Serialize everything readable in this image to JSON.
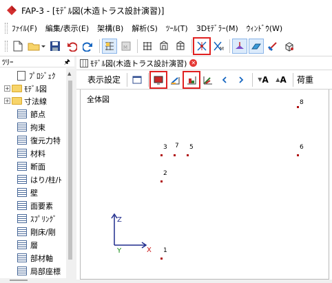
{
  "window": {
    "title": "FAP-3 - [ﾓﾃﾞﾙ図(木造トラス設計演習)]"
  },
  "menu": {
    "items": [
      "ﾌｧｲﾙ(F)",
      "編集/表示(E)",
      "架構(B)",
      "解析(S)",
      "ﾂｰﾙ(T)",
      "3Dﾓﾃﾞﾗｰ(M)",
      "ｳｨﾝﾄﾞｳ(W)"
    ]
  },
  "toolbar": {
    "buttons": [
      "new",
      "open",
      "save",
      "undo",
      "redo",
      "grid",
      "structure-model",
      "view-a",
      "view-b",
      "view-c",
      "support-node",
      "member-axis",
      "load-a",
      "load-b",
      "load-c",
      "load-d"
    ]
  },
  "tree": {
    "header": "ﾂﾘｰ",
    "pin_icon": "pin-icon",
    "items": [
      {
        "label": "ﾌﾟﾛｼﾞｪｸ",
        "icon": "file-icon"
      },
      {
        "label": "ﾓﾃﾞﾙ図",
        "icon": "folder-icon",
        "expander": "+"
      },
      {
        "label": "寸法線",
        "icon": "folder-icon",
        "expander": "+"
      },
      {
        "label": "節点",
        "icon": "table-icon"
      },
      {
        "label": "拘束",
        "icon": "table-icon"
      },
      {
        "label": "復元力特",
        "icon": "table-icon"
      },
      {
        "label": "材料",
        "icon": "table-icon"
      },
      {
        "label": "断面",
        "icon": "table-icon"
      },
      {
        "label": "はり/柱/ﾄ",
        "icon": "table-icon"
      },
      {
        "label": "壁",
        "icon": "table-icon"
      },
      {
        "label": "面要素",
        "icon": "table-icon"
      },
      {
        "label": "ｽﾌﾟﾘﾝｸﾞ",
        "icon": "table-icon"
      },
      {
        "label": "剛床/剛",
        "icon": "table-icon"
      },
      {
        "label": "層",
        "icon": "table-icon"
      },
      {
        "label": "部材軸",
        "icon": "table-icon"
      },
      {
        "label": "局部座標",
        "icon": "table-icon"
      }
    ]
  },
  "document": {
    "tab_title": "ﾓﾃﾞﾙ図(木造トラス設計演習)",
    "close_icon": "close-icon",
    "toolbar": {
      "display_settings": "表示設定",
      "load_label": "荷重",
      "label_a": "A",
      "label_b": "A"
    },
    "canvas": {
      "title": "全体図",
      "nodes": [
        "1",
        "2",
        "3",
        "7",
        "5",
        "6",
        "8"
      ],
      "axes": {
        "z": "Z",
        "x": "X",
        "y": "Y"
      }
    }
  },
  "colors": {
    "highlight": "#e02020",
    "node": "#b01010",
    "axis_z": "#1e2a8c",
    "axis_x": "#c81414",
    "axis_y": "#128a12"
  }
}
